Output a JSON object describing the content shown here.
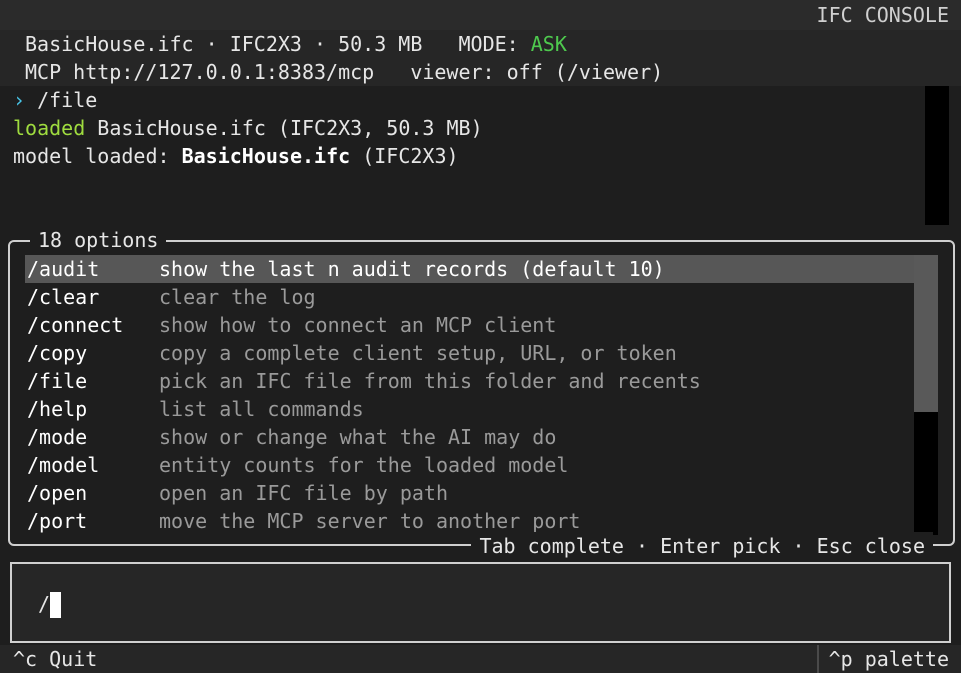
{
  "header": {
    "app_title": "IFC CONSOLE"
  },
  "info": {
    "file_name": "BasicHouse.ifc",
    "sep1": " · ",
    "schema": "IFC2X3",
    "sep2": " · ",
    "size": "50.3 MB",
    "mode_label": "MODE: ",
    "mode_value": "ASK",
    "mcp_line": "MCP http://127.0.0.1:8383/mcp   viewer: off (/viewer)"
  },
  "log": {
    "prompt_symbol": "›",
    "command": " /file",
    "loaded_word": "loaded",
    "loaded_rest": " BasicHouse.ifc (IFC2X3, 50.3 MB)",
    "model_prefix": "model loaded: ",
    "model_name": "BasicHouse.ifc",
    "model_suffix": " (IFC2X3)"
  },
  "palette": {
    "title": "18 options",
    "footer": "Tab complete · Enter pick · Esc close",
    "selected_index": 0,
    "scroll_position_fraction": 0.0,
    "options": [
      {
        "cmd": "/audit",
        "desc": "show the last n audit records (default 10)"
      },
      {
        "cmd": "/clear",
        "desc": "clear the log"
      },
      {
        "cmd": "/connect",
        "desc": "show how to connect an MCP client"
      },
      {
        "cmd": "/copy",
        "desc": "copy a complete client setup, URL, or token"
      },
      {
        "cmd": "/file",
        "desc": "pick an IFC file from this folder and recents"
      },
      {
        "cmd": "/help",
        "desc": "list all commands"
      },
      {
        "cmd": "/mode",
        "desc": "show or change what the AI may do"
      },
      {
        "cmd": "/model",
        "desc": "entity counts for the loaded model"
      },
      {
        "cmd": "/open",
        "desc": "open an IFC file by path"
      },
      {
        "cmd": "/port",
        "desc": "move the MCP server to another port"
      }
    ]
  },
  "input": {
    "value": "/"
  },
  "status": {
    "quit": "^c Quit",
    "palette": "^p palette"
  },
  "colors": {
    "accent_green": "#4ec94e",
    "loaded_green": "#9fdc3f",
    "prompt_cyan": "#48c5e8"
  }
}
